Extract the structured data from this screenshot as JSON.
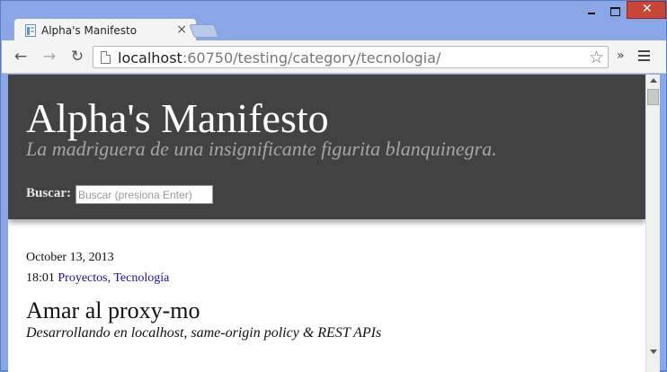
{
  "browser": {
    "tab_title": "Alpha's Manifesto",
    "tab_close": "×",
    "url_host": "localhost",
    "url_rest": ":60750/testing/category/tecnologia/",
    "extensions_label": "»"
  },
  "site": {
    "title": "Alpha's Manifesto",
    "tagline": "La madriguera de una insignificante figurita blanquinegra.",
    "search_label": "Buscar:",
    "search_placeholder": "Buscar (presiona Enter)"
  },
  "post": {
    "date": "October 13, 2013",
    "time": "18:01",
    "categories": [
      "Proyectos",
      "Tecnología"
    ],
    "separator": ", ",
    "title": "Amar al proxy-mo",
    "subtitle": "Desarrollando en localhost, same-origin policy & REST APIs"
  }
}
